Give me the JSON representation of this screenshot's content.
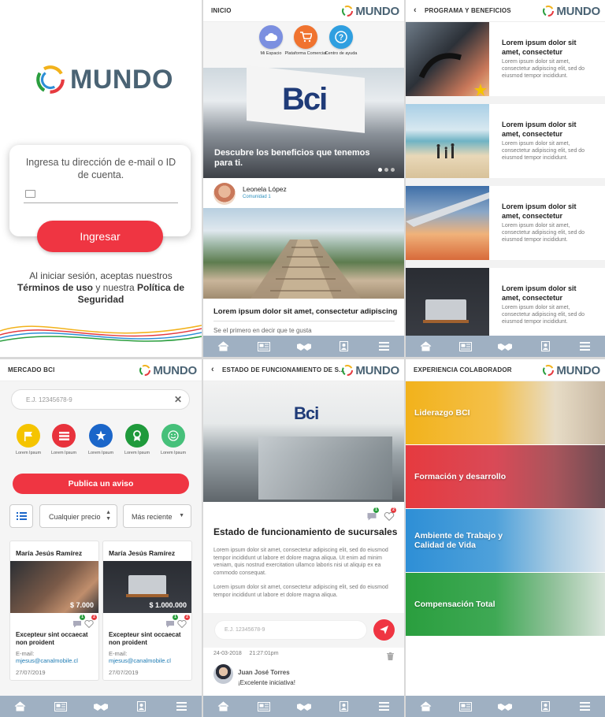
{
  "brand": {
    "name": "MUNDO"
  },
  "login": {
    "prompt": "Ingresa tu dirección de e-mail o ID de cuenta.",
    "submit_label": "Ingresar",
    "terms_prefix": "Al iniciar sesión, aceptas nuestros",
    "terms_link": "Términos de uso",
    "terms_mid": "y nuestra",
    "privacy_link": "Política de Seguridad"
  },
  "home": {
    "header_title": "INICIO",
    "quick_actions": [
      {
        "label": "Mi Espacio",
        "icon": "cloud-icon",
        "color": "#7b8fe0"
      },
      {
        "label": "Plataforma Comercial",
        "icon": "cart-icon",
        "color": "#f0732f"
      },
      {
        "label": "Centro de ayuda",
        "icon": "help-icon",
        "color": "#2f9fe0"
      }
    ],
    "hero_caption": "Descubre los beneficios que tenemos para ti.",
    "hero_sign": "Bci",
    "post": {
      "author": "Leonela López",
      "community": "Comunidad 1",
      "title": "Lorem ipsum dolor sit amet, consectetur adipiscing",
      "first_comment": "Se el primero en decir que te gusta"
    }
  },
  "programs": {
    "header_title": "PROGRAMA Y BENEFICIOS",
    "cards": [
      {
        "title": "Lorem ipsum dolor sit amet, consectetur",
        "desc": "Lorem ipsum dolor sit amet, consectetur adipiscing elit, sed do eiusmod tempor incididunt."
      },
      {
        "title": "Lorem ipsum dolor sit amet, consectetur",
        "desc": "Lorem ipsum dolor sit amet, consectetur adipiscing elit, sed do eiusmod tempor incididunt."
      },
      {
        "title": "Lorem ipsum dolor sit amet, consectetur",
        "desc": "Lorem ipsum dolor sit amet, consectetur adipiscing elit, sed do eiusmod tempor incididunt."
      },
      {
        "title": "Lorem ipsum dolor sit amet, consectetur",
        "desc": "Lorem ipsum dolor sit amet, consectetur adipiscing elit, sed do eiusmod tempor incididunt."
      }
    ]
  },
  "market": {
    "header_title": "MERCADO BCI",
    "search_placeholder": "E.J. 12345678-9",
    "categories": [
      {
        "label": "Lorem Ipsum",
        "color": "#f5c400",
        "icon": "flag-icon"
      },
      {
        "label": "Lorem Ipsum",
        "color": "#e8323c",
        "icon": "list-icon"
      },
      {
        "label": "Lorem Ipsum",
        "color": "#1b66c9",
        "icon": "star-icon"
      },
      {
        "label": "Lorem Ipsum",
        "color": "#1f9a3b",
        "icon": "award-icon"
      },
      {
        "label": "Lorem Ipsum",
        "color": "#46c07a",
        "icon": "smile-icon"
      }
    ],
    "publish_label": "Publica un aviso",
    "price_filter": "Cualquier precio",
    "sort_filter": "Más reciente",
    "listings": [
      {
        "seller": "María Jesús Ramírez",
        "price": "$ 7.000",
        "comments": "1",
        "likes": "2",
        "title": "Excepteur sint occaecat non proident",
        "email_label": "E-mail:",
        "email": "mjesus@canalmobile.cl",
        "date": "27/07/2019"
      },
      {
        "seller": "María Jesús Ramírez",
        "price": "$ 1.000.000",
        "comments": "1",
        "likes": "2",
        "title": "Excepteur sint occaecat non proident",
        "email_label": "E-mail:",
        "email": "mjesus@canalmobile.cl",
        "date": "27/07/2019"
      }
    ]
  },
  "article": {
    "header_title": "ESTADO DE FUNCIONAMIENTO DE S...",
    "hero_sign": "Bci",
    "comments_count": "1",
    "likes_count": "2",
    "title": "Estado de funcionamiento de sucursales",
    "body_1": "Lorem ipsum dolor sit amet, consectetur adipiscing elit, sed do eiusmod tempor incididunt ut labore et dolore magna aliqua. Ut enim ad minim veniam, quis nostrud exercitation ullamco laboris nisi ut aliquip ex ea commodo consequat.",
    "body_2": "Lorem ipsum dolor sit amet, consectetur adipiscing elit, sed do eiusmod tempor incididunt ut labore et dolore magna aliqua.",
    "comment_placeholder": "E.J. 12345678-9",
    "comment_date": "24-03-2018",
    "comment_time": "21:27:01pm",
    "comment_author": "Juan José Torres",
    "comment_text": "¡Excelente iniciativa!"
  },
  "experience": {
    "header_title": "EXPERIENCIA COLABORADOR",
    "bands": [
      {
        "label": "Liderazgo BCI",
        "color": "#f2b21b"
      },
      {
        "label": "Formación y desarrollo",
        "color": "#e63a3f"
      },
      {
        "label": "Ambiente de Trabajo y Calidad de Vida",
        "color": "#2e8fd6"
      },
      {
        "label": "Compensación Total",
        "color": "#2a9e3e"
      }
    ]
  },
  "nav": {
    "items": [
      "home-icon",
      "news-icon",
      "handshake-icon",
      "contact-icon",
      "menu-icon"
    ],
    "color": "#9fb0c2"
  }
}
